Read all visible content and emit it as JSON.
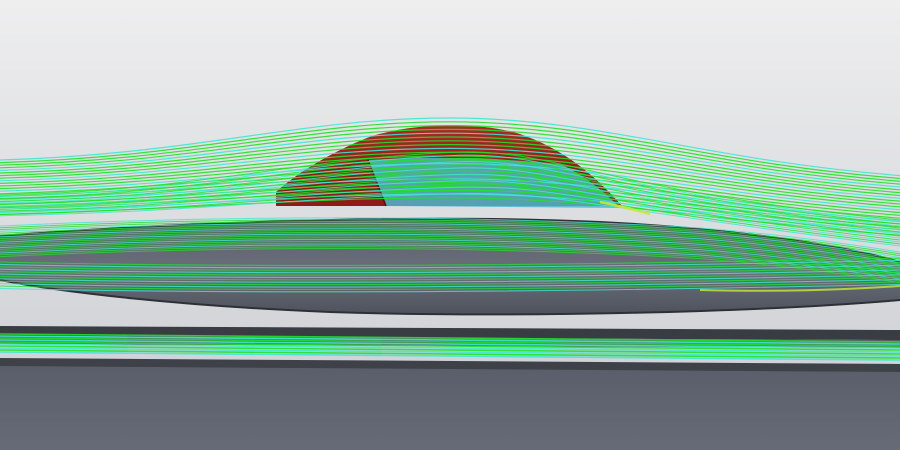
{
  "viewport": {
    "background_top": "#eeeeef",
    "background_bottom": "#c9ccd1"
  },
  "colors": {
    "body_top": "#e8e9ec",
    "body_side": "#60646f",
    "body_edge": "#2f3036",
    "canopy_red": "#9b1f1b",
    "canopy_red_dark": "#6e100e",
    "canopy_glass": "#4fb8cf",
    "ground_face": "#5e626f",
    "ground_edge": "#3a3c44",
    "streamline_green": "#22e02a",
    "streamline_cyan": "#3fe6d2",
    "streamline_yellow": "#c9e83a"
  },
  "icons": [
    "streamline-flow-field"
  ]
}
